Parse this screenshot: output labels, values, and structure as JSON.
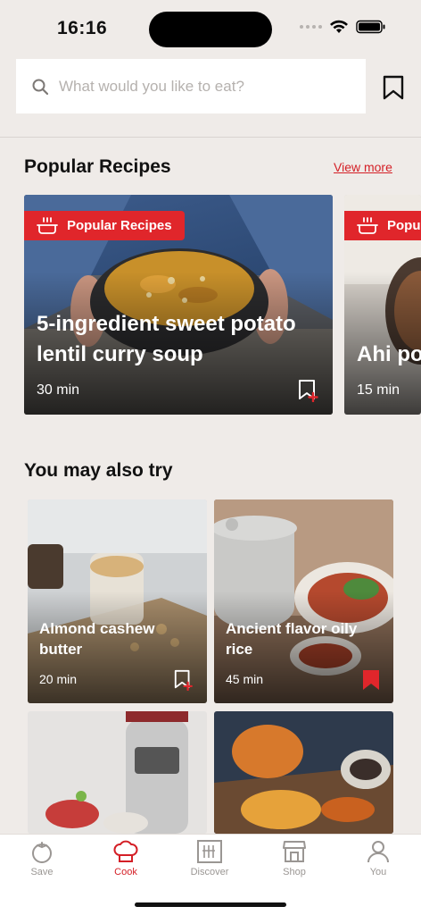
{
  "status_bar": {
    "time": "16:16"
  },
  "search": {
    "placeholder": "What would you like to eat?"
  },
  "popular": {
    "title": "Popular Recipes",
    "view_more": "View more",
    "cards": [
      {
        "badge": "Popular Recipes",
        "title": "5-ingredient sweet potato lentil curry soup",
        "time": "30 min"
      },
      {
        "badge": "Popu",
        "title": "Ahi po",
        "time": "15 min"
      }
    ]
  },
  "also_try": {
    "title": "You may also try",
    "cards": [
      {
        "title": "Almond cashew butter",
        "time": "20 min",
        "saved": false
      },
      {
        "title": "Ancient flavor oily rice",
        "time": "45 min",
        "saved": true
      },
      {
        "title": "",
        "time": ""
      },
      {
        "title": "",
        "time": ""
      }
    ]
  },
  "tabs": [
    {
      "label": "Save",
      "icon": "tomato-icon"
    },
    {
      "label": "Cook",
      "icon": "chef-hat-icon",
      "active": true
    },
    {
      "label": "Discover",
      "icon": "discover-icon"
    },
    {
      "label": "Shop",
      "icon": "shop-icon"
    },
    {
      "label": "You",
      "icon": "person-icon"
    }
  ],
  "colors": {
    "accent": "#d41f26",
    "background": "#efebe8"
  }
}
